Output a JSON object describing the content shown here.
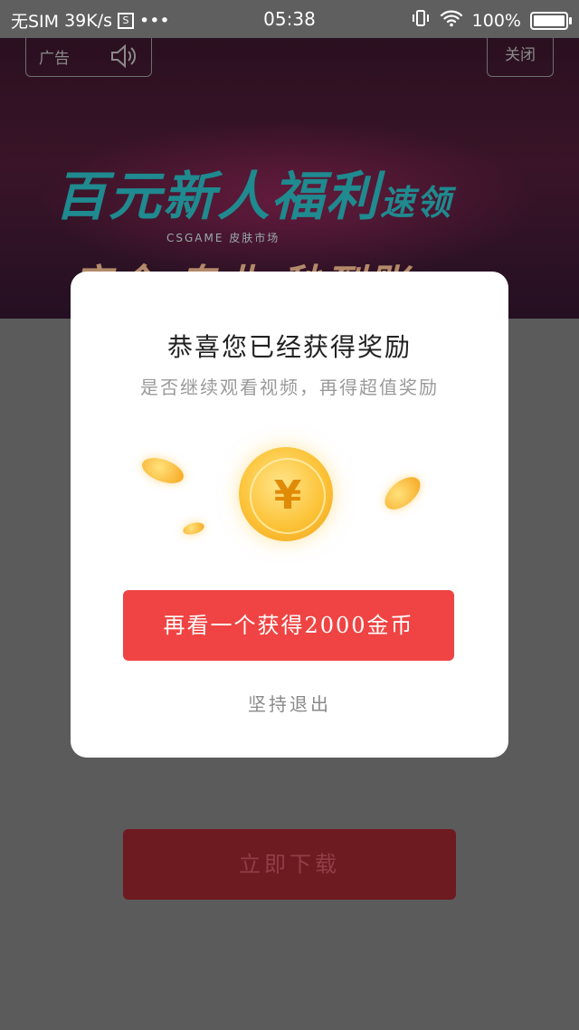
{
  "status_bar": {
    "carrier": "无SIM",
    "speed": "39K/s",
    "s_icon_letter": "S",
    "more": "•••",
    "time": "05:38",
    "battery": "100%"
  },
  "ad": {
    "label": "广告",
    "close_label": "关闭",
    "headline_main": "百元新人福利",
    "headline_small": "速领",
    "subline": "CSGAME 皮肤市场",
    "line3": "安全 专业 秒到账"
  },
  "dialog": {
    "title": "恭喜您已经获得奖励",
    "subtitle": "是否继续观看视频，再得超值奖励",
    "coin_symbol": "¥",
    "cta_label": "再看一个获得2000金币",
    "quit_label": "坚持退出"
  },
  "download": {
    "label": "立即下载"
  },
  "colors": {
    "cta": "#ef4443",
    "overlay": "#5b5b5b",
    "coin": "#fcc338"
  }
}
